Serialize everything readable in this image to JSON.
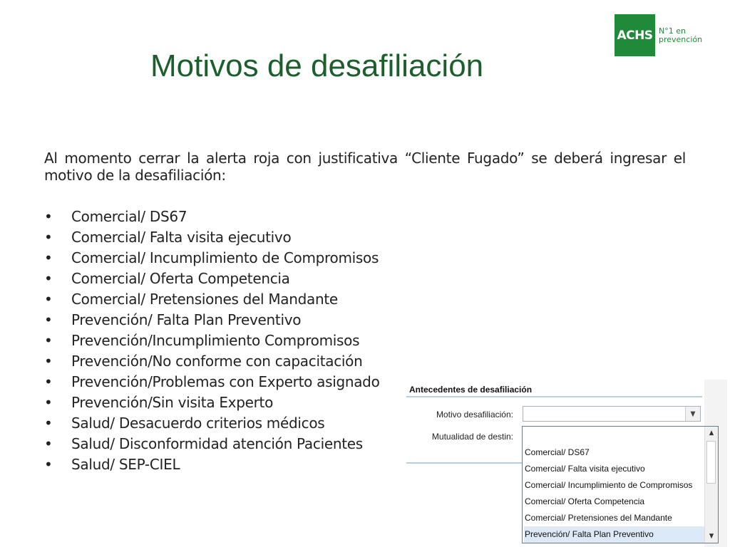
{
  "logo": {
    "brand": "ACHS",
    "tagline_line1": "N°1 en",
    "tagline_line2": "prevención"
  },
  "title": "Motivos de desafiliación",
  "intro": "Al momento cerrar la alerta roja con justificativa “Cliente Fugado” se deberá ingresar el motivo de la desafiliación:",
  "bullet_char": "•",
  "reasons": [
    "Comercial/ DS67",
    "Comercial/ Falta visita ejecutivo",
    "Comercial/ Incumplimiento de Compromisos",
    "Comercial/ Oferta Competencia",
    "Comercial/ Pretensiones del Mandante",
    "Prevención/ Falta Plan Preventivo",
    "Prevención/Incumplimiento Compromisos",
    "Prevención/No conforme con capacitación",
    "Prevención/Problemas con Experto asignado",
    "Prevención/Sin visita Experto",
    "Salud/ Desacuerdo criterios médicos",
    "Salud/ Disconformidad atención Pacientes",
    "Salud/ SEP-CIEL"
  ],
  "form": {
    "header": "Antecedentes de desafiliación",
    "motivo_label": "Motivo desafiliación:",
    "motivo_value": "",
    "mutualidad_label": "Mutualidad de destin:",
    "dropdown_options": [
      "Comercial/ DS67",
      "Comercial/ Falta visita ejecutivo",
      "Comercial/ Incumplimiento de Compromisos",
      "Comercial/ Oferta Competencia",
      "Comercial/ Pretensiones del Mandante",
      "Prevención/ Falta Plan Preventivo"
    ],
    "selected_option": "Prevención/ Falta Plan Preventivo",
    "icons": {
      "combo_arrow": "chevron-down-icon",
      "scroll_up": "scroll-up-icon",
      "scroll_down": "scroll-down-icon"
    }
  },
  "colors": {
    "title": "#1c5e2c",
    "brand": "#1f8a3a",
    "selection": "#dde9f6"
  }
}
